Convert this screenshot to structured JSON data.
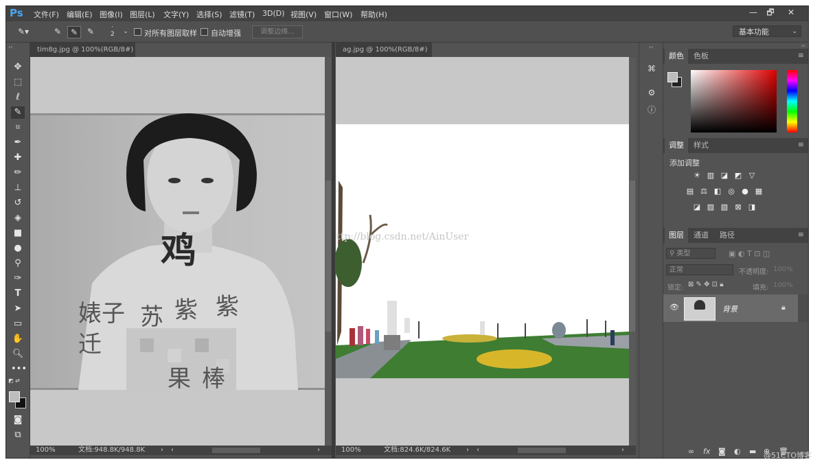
{
  "app": {
    "logo": "Ps"
  },
  "menu": [
    "文件(F)",
    "编辑(E)",
    "图像(I)",
    "图层(L)",
    "文字(Y)",
    "选择(S)",
    "滤镜(T)",
    "3D(D)",
    "视图(V)",
    "窗口(W)",
    "帮助(H)"
  ],
  "window_controls": {
    "minimize": "—",
    "restore": "🗗",
    "close": "✕"
  },
  "options": {
    "brush_size": "2",
    "sample_all_layers": "对所有图层取样",
    "auto_enhance": "自动增强",
    "refine_edge": "调整边缘...",
    "workspace": "基本功能"
  },
  "documents": [
    {
      "tab": "tim8g.jpg @ 100%(RGB/8#)",
      "zoom": "100%",
      "doc_info": "文档:948.8K/948.8K"
    },
    {
      "tab": "ag.jpg @ 100%(RGB/8#)",
      "zoom": "100%",
      "doc_info": "文档:824.6K/824.6K"
    }
  ],
  "image_text": {
    "watermark": "http://blog.csdn.net/AinUser",
    "calligraphy_large": "鸡",
    "calligraphy_small": [
      "婊子",
      "苏",
      "紫",
      "紫",
      "迁",
      "果",
      "棒"
    ]
  },
  "panels": {
    "color": {
      "tabs": [
        "颜色",
        "色板"
      ]
    },
    "adjustments": {
      "tabs": [
        "调整",
        "样式"
      ],
      "add_label": "添加调整"
    },
    "layers": {
      "tabs": [
        "图层",
        "通道",
        "路径"
      ],
      "filter_placeholder": "类型",
      "blend_mode": "正常",
      "opacity_label": "不透明度:",
      "opacity_value": "100%",
      "lock_label": "锁定:",
      "fill_label": "填充:",
      "fill_value": "100%",
      "layer_name": "背景"
    }
  },
  "footer_watermark": "@51CTO博客",
  "colors": {
    "app_bg": "#535353",
    "menubar": "#424242",
    "canvas_bg": "#c8c8c8",
    "accent_logo": "#4aa6f0"
  }
}
